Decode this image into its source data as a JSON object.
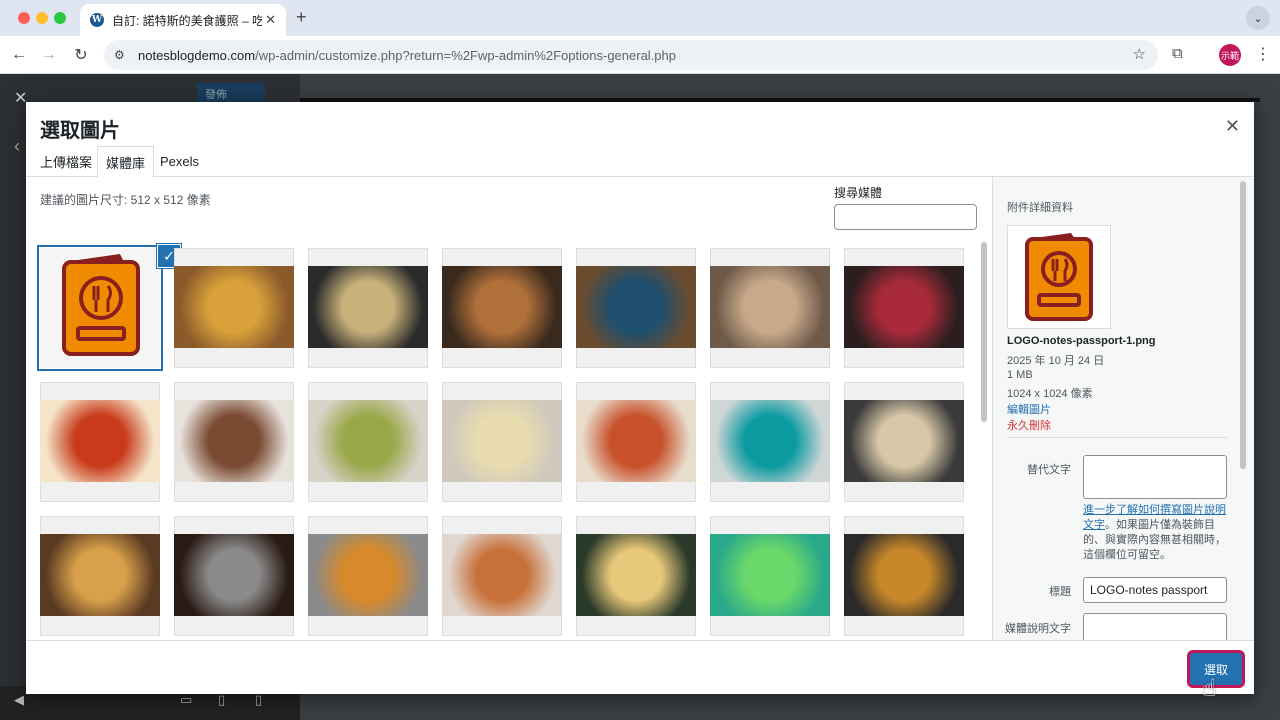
{
  "browser": {
    "tab_title": "自訂: 諾特斯的美食護照 – 吃遍",
    "new_tab_icon": "+",
    "url_domain": "notesblogdemo.com",
    "url_path": "/wp-admin/customize.php?return=%2Fwp-admin%2Foptions-general.php",
    "profile_label": "示範",
    "colors": {
      "close": "#ff5f57",
      "minimize": "#febc2e",
      "maximize": "#28c840"
    }
  },
  "customizer": {
    "publish_label": "發佈"
  },
  "modal": {
    "title": "選取圖片",
    "tabs": [
      {
        "label": "上傳檔案",
        "active": false
      },
      {
        "label": "媒體庫",
        "active": true
      },
      {
        "label": "Pexels",
        "active": false
      }
    ],
    "hint": "建議的圖片尺寸: 512 x 512 像素",
    "search_label": "搜尋媒體",
    "select_button": "選取"
  },
  "media_grid": [
    {
      "name": "logo-passport",
      "selected": true,
      "colors": [
        "#f5f5f5",
        "#f08a00"
      ]
    },
    {
      "name": "burger-fries",
      "colors": [
        "#8a5a2b",
        "#d9a13a"
      ]
    },
    {
      "name": "ramen-bowl",
      "colors": [
        "#2b2b2b",
        "#c9b27a"
      ]
    },
    {
      "name": "beef-noodle-soup",
      "colors": [
        "#3a2a1e",
        "#b0703a"
      ]
    },
    {
      "name": "fried-chicken-plate",
      "colors": [
        "#6b4b2e",
        "#1e4f6e"
      ]
    },
    {
      "name": "grilled-meat-platter",
      "colors": [
        "#6e5a4a",
        "#c9a98a"
      ]
    },
    {
      "name": "hotpot-beef",
      "colors": [
        "#2a1e1e",
        "#a82a3a"
      ]
    },
    {
      "name": "borscht-soup",
      "colors": [
        "#f4e4c8",
        "#c83a1a"
      ]
    },
    {
      "name": "tiramisu-dessert",
      "colors": [
        "#e8e2dc",
        "#7a4a32"
      ]
    },
    {
      "name": "pasta-dishes",
      "colors": [
        "#d8d2c8",
        "#9aa84a"
      ]
    },
    {
      "name": "risotto-plate",
      "colors": [
        "#cfc8bd",
        "#e8dcb0"
      ]
    },
    {
      "name": "pepperoni-pizza",
      "colors": [
        "#e8dccb",
        "#c8502a"
      ]
    },
    {
      "name": "teal-bowl-berries",
      "colors": [
        "#cfd6d6",
        "#0a9aa0"
      ]
    },
    {
      "name": "food-tray-hands",
      "colors": [
        "#3a3a3a",
        "#d8c8a8"
      ]
    },
    {
      "name": "beer-bar",
      "colors": [
        "#5a3a22",
        "#d8a04a"
      ]
    },
    {
      "name": "platter-overhead",
      "colors": [
        "#2a1a14",
        "#8a8a8a"
      ]
    },
    {
      "name": "curry-bowl",
      "colors": [
        "#8a8a8a",
        "#d88a2a"
      ]
    },
    {
      "name": "shrimp-noodles",
      "colors": [
        "#e0d8d0",
        "#c8703a"
      ]
    },
    {
      "name": "tacos-lime",
      "colors": [
        "#2a3a2a",
        "#e8c87a"
      ]
    },
    {
      "name": "decorated-eggs",
      "colors": [
        "#2aa88a",
        "#6ad86a"
      ]
    },
    {
      "name": "tacos-board",
      "colors": [
        "#2a2a2a",
        "#c8882a"
      ]
    }
  ],
  "details": {
    "heading": "附件詳細資料",
    "filename": "LOGO-notes-passport-1.png",
    "date": "2025 年 10 月 24 日",
    "size": "1 MB",
    "dimensions": "1024 x 1024 像素",
    "edit_link": "編輯圖片",
    "delete_link": "永久刪除",
    "alt_label": "替代文字",
    "alt_help_link": "進一步了解如何撰寫圖片說明文字",
    "alt_help_text": "。如果圖片僅為裝飾目的、與實際內容無甚相關時，這個欄位可留空。",
    "title_label": "標題",
    "title_value": "LOGO-notes passport",
    "caption_label": "媒體說明文字"
  }
}
